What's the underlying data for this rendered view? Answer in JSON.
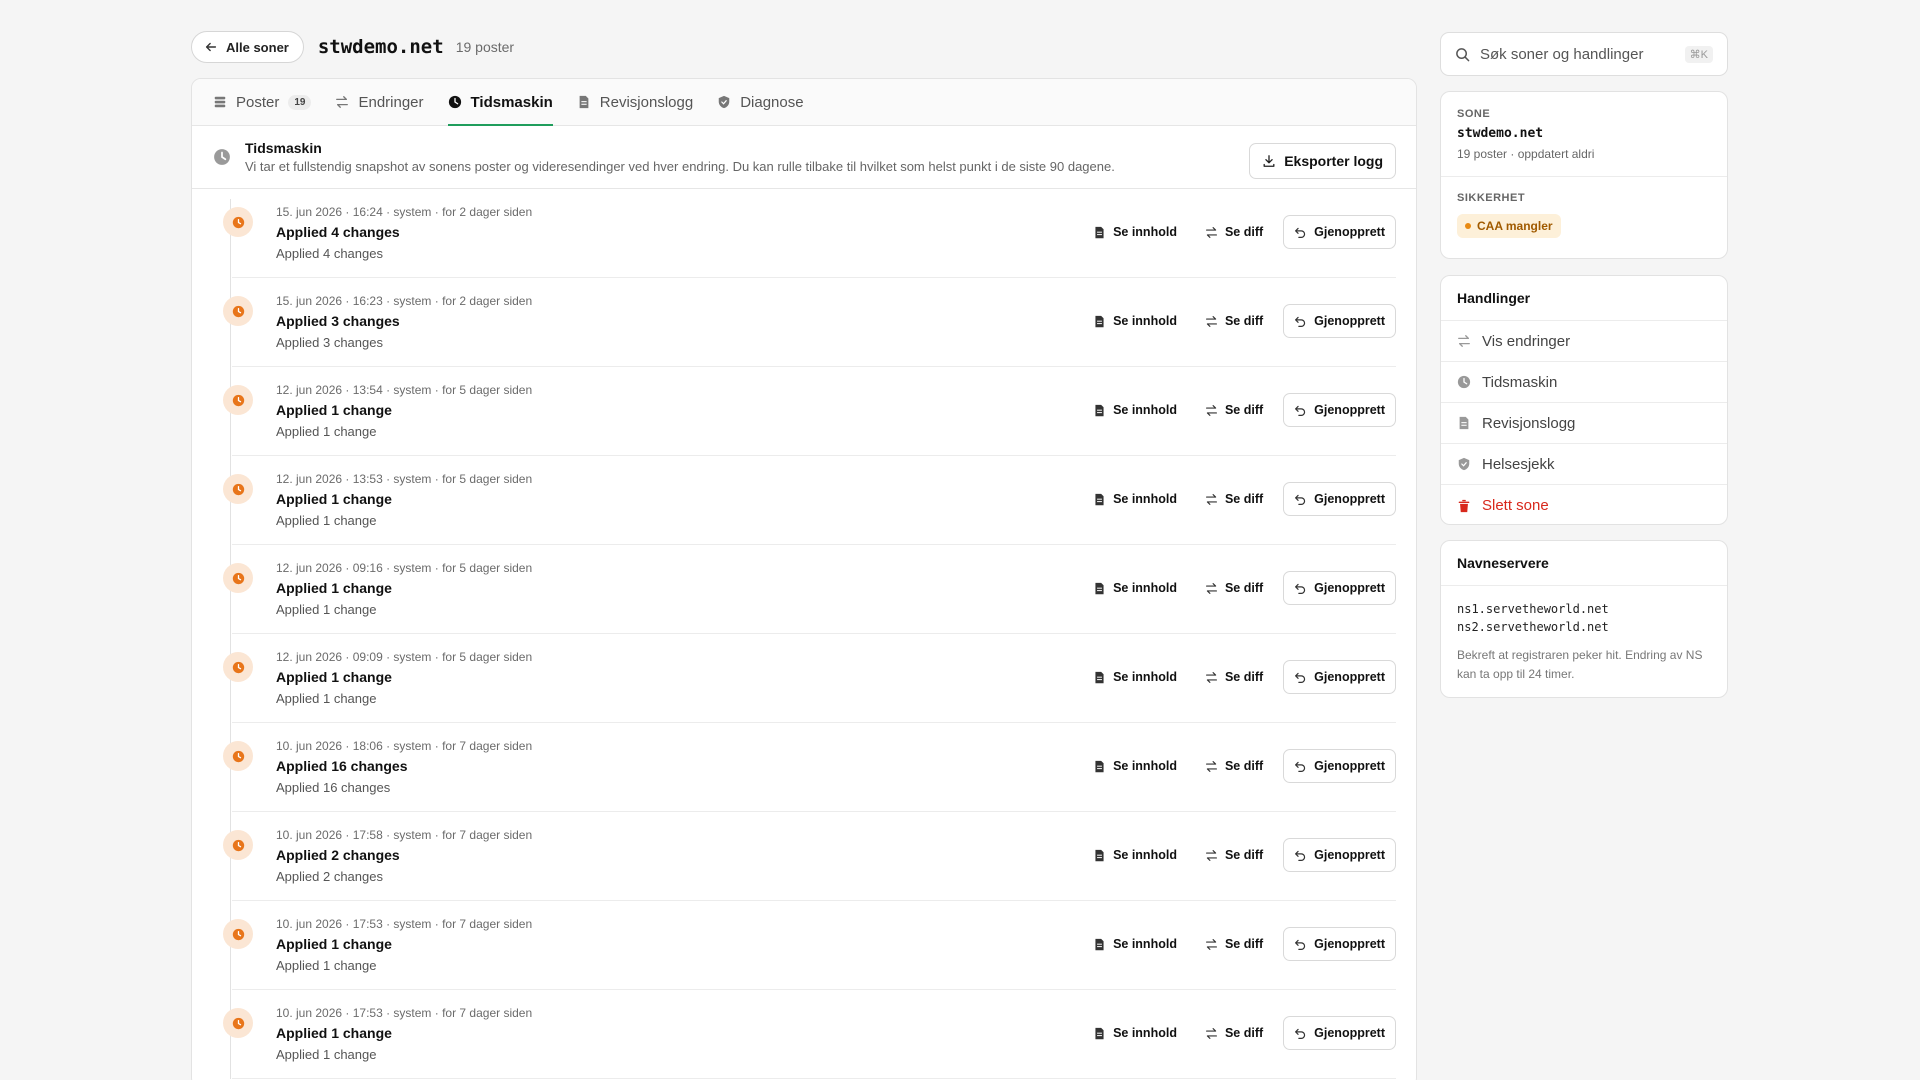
{
  "header": {
    "back_label": "Alle soner",
    "zone": "stwdemo.net",
    "count": "19 poster"
  },
  "tabs": [
    {
      "label": "Poster",
      "badge": "19",
      "icon": "list-icon"
    },
    {
      "label": "Endringer",
      "icon": "arrows-icon"
    },
    {
      "label": "Tidsmaskin",
      "icon": "clock-icon",
      "active": true
    },
    {
      "label": "Revisjonslogg",
      "icon": "document-icon"
    },
    {
      "label": "Diagnose",
      "icon": "shield-icon"
    }
  ],
  "intro": {
    "title": "Tidsmaskin",
    "description": "Vi tar et fullstendig snapshot av sonens poster og videresendinger ved hver endring. Du kan rulle tilbake til hvilket som helst punkt i de siste 90 dagene.",
    "export_label": "Eksporter logg"
  },
  "entry_actions": {
    "view": "Se innhold",
    "diff": "Se diff",
    "restore": "Gjenopprett"
  },
  "entries": [
    {
      "meta": "15. jun 2026 · 16:24 · system · for 2 dager siden",
      "title": "Applied 4 changes",
      "desc": "Applied 4 changes"
    },
    {
      "meta": "15. jun 2026 · 16:23 · system · for 2 dager siden",
      "title": "Applied 3 changes",
      "desc": "Applied 3 changes"
    },
    {
      "meta": "12. jun 2026 · 13:54 · system · for 5 dager siden",
      "title": "Applied 1 change",
      "desc": "Applied 1 change"
    },
    {
      "meta": "12. jun 2026 · 13:53 · system · for 5 dager siden",
      "title": "Applied 1 change",
      "desc": "Applied 1 change"
    },
    {
      "meta": "12. jun 2026 · 09:16 · system · for 5 dager siden",
      "title": "Applied 1 change",
      "desc": "Applied 1 change"
    },
    {
      "meta": "12. jun 2026 · 09:09 · system · for 5 dager siden",
      "title": "Applied 1 change",
      "desc": "Applied 1 change"
    },
    {
      "meta": "10. jun 2026 · 18:06 · system · for 7 dager siden",
      "title": "Applied 16 changes",
      "desc": "Applied 16 changes"
    },
    {
      "meta": "10. jun 2026 · 17:58 · system · for 7 dager siden",
      "title": "Applied 2 changes",
      "desc": "Applied 2 changes"
    },
    {
      "meta": "10. jun 2026 · 17:53 · system · for 7 dager siden",
      "title": "Applied 1 change",
      "desc": "Applied 1 change"
    },
    {
      "meta": "10. jun 2026 · 17:53 · system · for 7 dager siden",
      "title": "Applied 1 change",
      "desc": "Applied 1 change"
    }
  ],
  "search": {
    "placeholder": "Søk soner og handlinger",
    "shortcut": "⌘K"
  },
  "zone_card": {
    "zone_label": "SONE",
    "zone_name": "stwdemo.net",
    "zone_sub": "19 poster · oppdatert aldri",
    "security_label": "SIKKERHET",
    "security_badge": "CAA mangler"
  },
  "actions_card": {
    "title": "Handlinger",
    "items": [
      {
        "label": "Vis endringer",
        "icon": "arrows-icon"
      },
      {
        "label": "Tidsmaskin",
        "icon": "clock-icon"
      },
      {
        "label": "Revisjonslogg",
        "icon": "document-icon"
      },
      {
        "label": "Helsesjekk",
        "icon": "shield-icon"
      },
      {
        "label": "Slett sone",
        "icon": "trash-icon",
        "danger": true
      }
    ]
  },
  "ns_card": {
    "title": "Navneservere",
    "servers": [
      "ns1.servetheworld.net",
      "ns2.servetheworld.net"
    ],
    "note": "Bekreft at registraren peker hit. Endring av NS kan ta opp til 24 timer."
  },
  "colors": {
    "accent_green": "#1f9d5c",
    "timeline_orange": "#e8751a",
    "danger_red": "#d8281c",
    "warning_bg": "#fdf0d9"
  }
}
